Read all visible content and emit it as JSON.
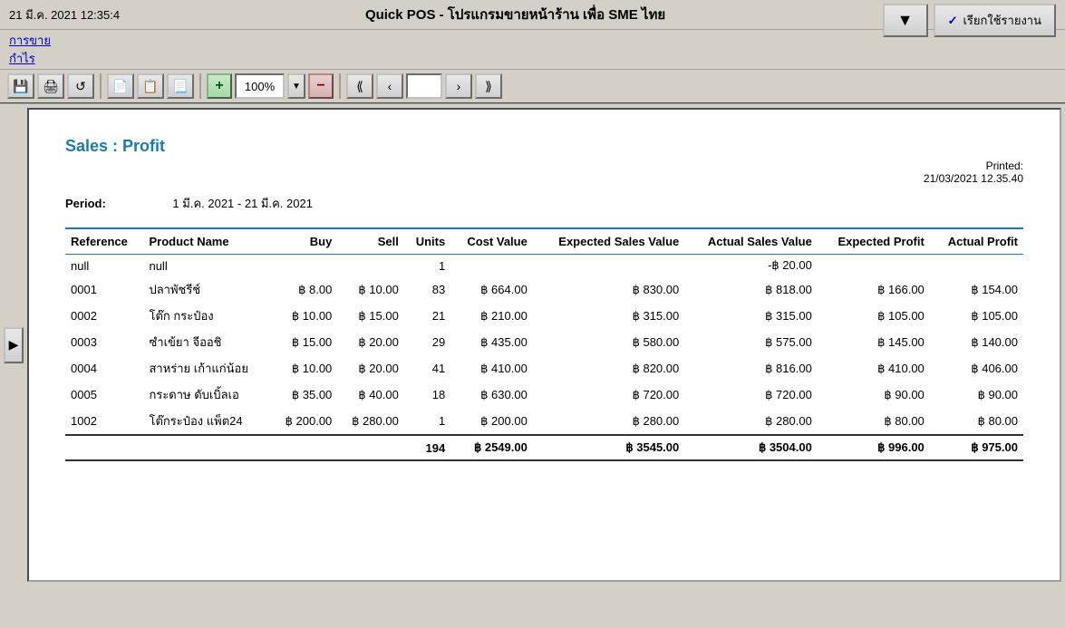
{
  "titleBar": {
    "datetime": "21 มี.ค. 2021 12:35:4",
    "appTitle": "Quick POS - โปรแกรมขายหน้าร้าน เพื่อ SME ไทย"
  },
  "menuBar": {
    "items": [
      {
        "label": "การขาย"
      },
      {
        "label": "กำไร"
      }
    ]
  },
  "topButtons": [
    {
      "label": "▼",
      "name": "dropdown-button"
    },
    {
      "label": "✓ เรียกใช้รายงาน",
      "name": "call-report-button"
    }
  ],
  "toolbar": {
    "zoomLevel": "100%",
    "pageNumber": ""
  },
  "report": {
    "title": "Sales : Profit",
    "printedLabel": "Printed:",
    "printedDate": "21/03/2021 12.35.40",
    "periodLabel": "Period:",
    "periodValue": "1 มี.ค. 2021 - 21 มี.ค. 2021",
    "columns": [
      {
        "key": "reference",
        "label": "Reference"
      },
      {
        "key": "productName",
        "label": "Product Name"
      },
      {
        "key": "buy",
        "label": "Buy"
      },
      {
        "key": "sell",
        "label": "Sell"
      },
      {
        "key": "units",
        "label": "Units"
      },
      {
        "key": "costValue",
        "label": "Cost Value"
      },
      {
        "key": "expectedSalesValue",
        "label": "Expected Sales Value"
      },
      {
        "key": "actualSalesValue",
        "label": "Actual Sales Value"
      },
      {
        "key": "expectedProfit",
        "label": "Expected Profit"
      },
      {
        "key": "actualProfit",
        "label": "Actual Profit"
      }
    ],
    "rows": [
      {
        "reference": "null",
        "productName": "null",
        "buy": "",
        "sell": "",
        "units": "1",
        "costValue": "",
        "expectedSalesValue": "",
        "actualSalesValue": "-฿ 20.00",
        "expectedProfit": "",
        "actualProfit": ""
      },
      {
        "reference": "0001",
        "productName": "ปลาพัชรีช์",
        "buy": "฿ 8.00",
        "sell": "฿ 10.00",
        "units": "83",
        "costValue": "฿ 664.00",
        "expectedSalesValue": "฿ 830.00",
        "actualSalesValue": "฿ 818.00",
        "expectedProfit": "฿ 166.00",
        "actualProfit": "฿ 154.00"
      },
      {
        "reference": "0002",
        "productName": "โต๊ก กระป๋อง",
        "buy": "฿ 10.00",
        "sell": "฿ 15.00",
        "units": "21",
        "costValue": "฿ 210.00",
        "expectedSalesValue": "฿ 315.00",
        "actualSalesValue": "฿ 315.00",
        "expectedProfit": "฿ 105.00",
        "actualProfit": "฿ 105.00"
      },
      {
        "reference": "0003",
        "productName": "ซำเข้ยา จีออชิ",
        "buy": "฿ 15.00",
        "sell": "฿ 20.00",
        "units": "29",
        "costValue": "฿ 435.00",
        "expectedSalesValue": "฿ 580.00",
        "actualSalesValue": "฿ 575.00",
        "expectedProfit": "฿ 145.00",
        "actualProfit": "฿ 140.00"
      },
      {
        "reference": "0004",
        "productName": "สาหร่าย เก้าแก่น้อย",
        "buy": "฿ 10.00",
        "sell": "฿ 20.00",
        "units": "41",
        "costValue": "฿ 410.00",
        "expectedSalesValue": "฿ 820.00",
        "actualSalesValue": "฿ 816.00",
        "expectedProfit": "฿ 410.00",
        "actualProfit": "฿ 406.00"
      },
      {
        "reference": "0005",
        "productName": "กระดาษ ดับเบิ้ลเอ",
        "buy": "฿ 35.00",
        "sell": "฿ 40.00",
        "units": "18",
        "costValue": "฿ 630.00",
        "expectedSalesValue": "฿ 720.00",
        "actualSalesValue": "฿ 720.00",
        "expectedProfit": "฿ 90.00",
        "actualProfit": "฿ 90.00"
      },
      {
        "reference": "1002",
        "productName": "โต๊กระป๋อง แพ็ต24",
        "buy": "฿ 200.00",
        "sell": "฿ 280.00",
        "units": "1",
        "costValue": "฿ 200.00",
        "expectedSalesValue": "฿ 280.00",
        "actualSalesValue": "฿ 280.00",
        "expectedProfit": "฿ 80.00",
        "actualProfit": "฿ 80.00"
      }
    ],
    "totals": {
      "units": "194",
      "costValue": "฿ 2549.00",
      "expectedSalesValue": "฿ 3545.00",
      "actualSalesValue": "฿ 3504.00",
      "expectedProfit": "฿ 996.00",
      "actualProfit": "฿ 975.00"
    }
  }
}
